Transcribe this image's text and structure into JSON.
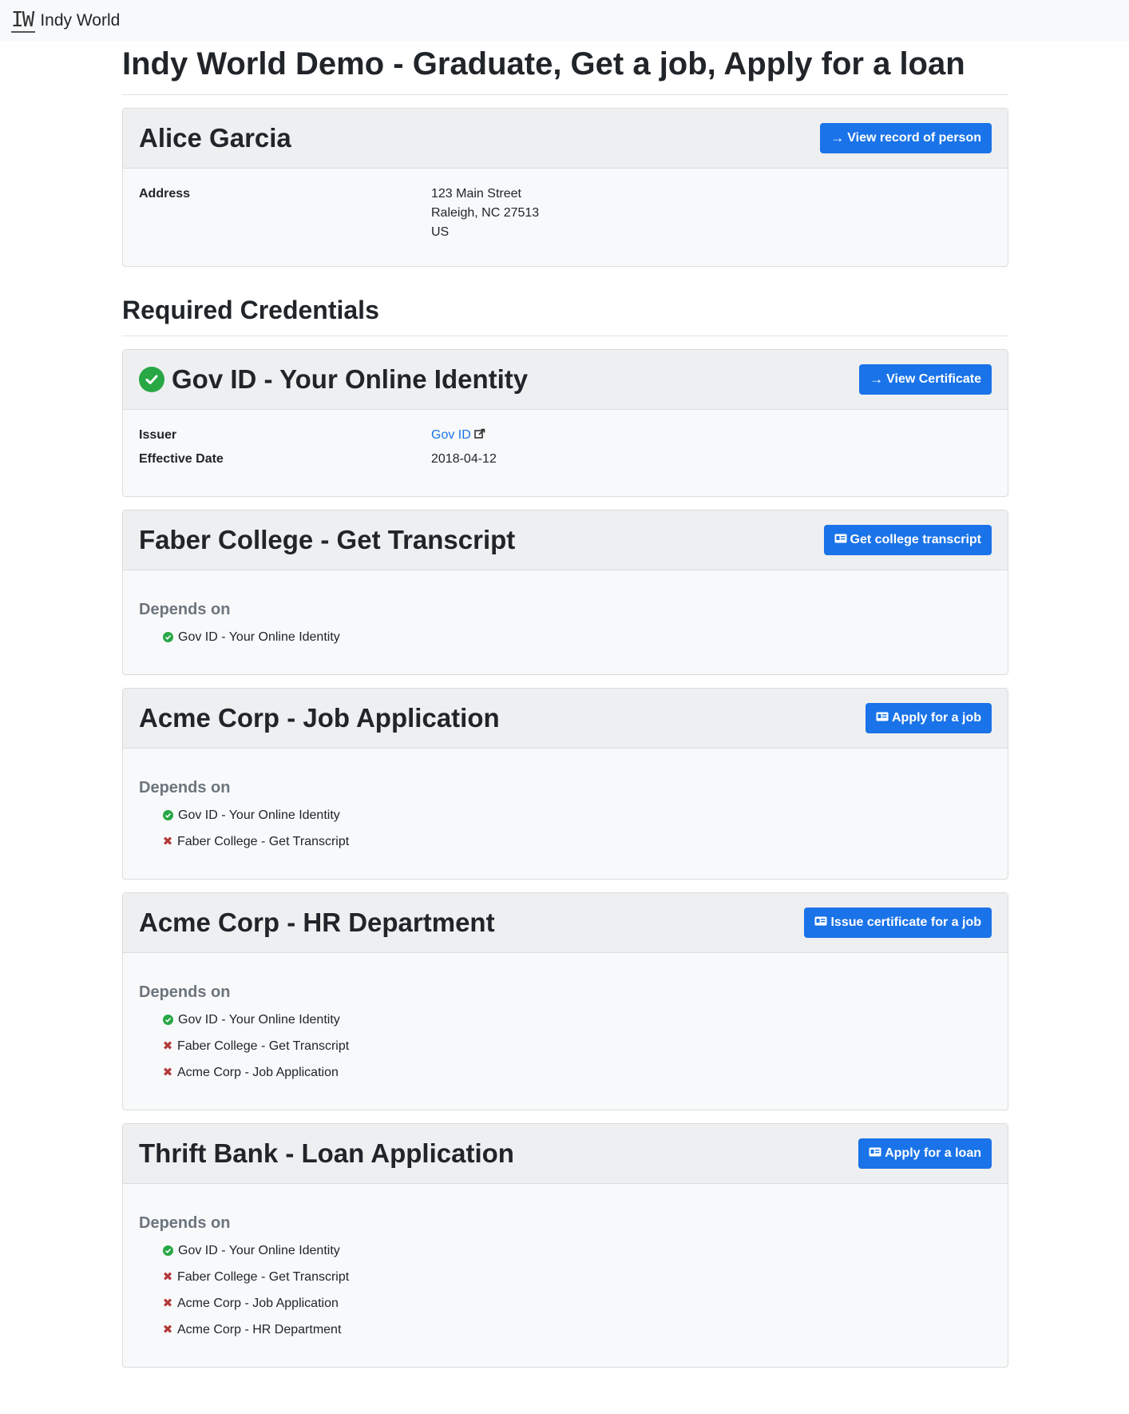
{
  "navbar": {
    "logo": "IW",
    "brand": "Indy World"
  },
  "page": {
    "title": "Indy World Demo - Graduate, Get a job, Apply for a loan"
  },
  "person": {
    "name": "Alice Garcia",
    "button": "View record of person",
    "address_label": "Address",
    "address_lines": [
      "123 Main Street",
      "Raleigh, NC  27513",
      "US"
    ]
  },
  "section": {
    "title": "Required Credentials"
  },
  "credentials": [
    {
      "title": "Gov ID - Your Online Identity",
      "status": "complete",
      "button": "View Certificate",
      "issuer_label": "Issuer",
      "issuer": "Gov ID",
      "effective_label": "Effective Date",
      "effective_date": "2018-04-12"
    },
    {
      "title": "Faber College - Get Transcript",
      "button": "Get college transcript",
      "depends_label": "Depends on",
      "depends": [
        {
          "label": "Gov ID - Your Online Identity",
          "status": "ok"
        }
      ]
    },
    {
      "title": "Acme Corp - Job Application",
      "button": "Apply for a job",
      "depends_label": "Depends on",
      "depends": [
        {
          "label": "Gov ID - Your Online Identity",
          "status": "ok"
        },
        {
          "label": "Faber College - Get Transcript",
          "status": "missing"
        }
      ]
    },
    {
      "title": "Acme Corp - HR Department",
      "button": "Issue certificate for a job",
      "depends_label": "Depends on",
      "depends": [
        {
          "label": "Gov ID - Your Online Identity",
          "status": "ok"
        },
        {
          "label": "Faber College - Get Transcript",
          "status": "missing"
        },
        {
          "label": "Acme Corp - Job Application",
          "status": "missing"
        }
      ]
    },
    {
      "title": "Thrift Bank - Loan Application",
      "button": "Apply for a loan",
      "depends_label": "Depends on",
      "depends": [
        {
          "label": "Gov ID - Your Online Identity",
          "status": "ok"
        },
        {
          "label": "Faber College - Get Transcript",
          "status": "missing"
        },
        {
          "label": "Acme Corp - Job Application",
          "status": "missing"
        },
        {
          "label": "Acme Corp - HR Department",
          "status": "missing"
        }
      ]
    }
  ],
  "colors": {
    "primary": "#1a73e8",
    "success": "#28a745",
    "danger": "#b33a3a"
  }
}
